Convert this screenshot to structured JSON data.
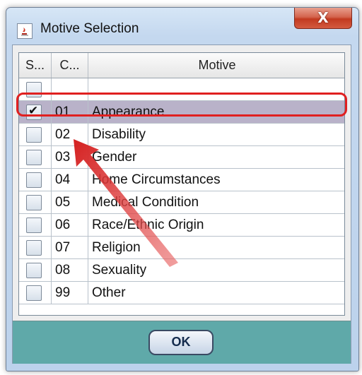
{
  "window": {
    "title": "Motive Selection",
    "close_label": "X"
  },
  "table": {
    "headers": {
      "select": "S...",
      "code": "C...",
      "motive": "Motive"
    },
    "rows": [
      {
        "code": "",
        "motive": "",
        "checked": false
      },
      {
        "code": "01",
        "motive": "Appearance",
        "checked": true
      },
      {
        "code": "02",
        "motive": "Disability",
        "checked": false
      },
      {
        "code": "03",
        "motive": "Gender",
        "checked": false
      },
      {
        "code": "04",
        "motive": "Home Circumstances",
        "checked": false
      },
      {
        "code": "05",
        "motive": "Medical Condition",
        "checked": false
      },
      {
        "code": "06",
        "motive": "Race/Ethnic Origin",
        "checked": false
      },
      {
        "code": "07",
        "motive": "Religion",
        "checked": false
      },
      {
        "code": "08",
        "motive": "Sexuality",
        "checked": false
      },
      {
        "code": "99",
        "motive": "Other",
        "checked": false
      }
    ]
  },
  "footer": {
    "ok_label": "OK"
  },
  "colors": {
    "selected_row": "#b9b2c9",
    "highlight": "#e02020",
    "footer_bg": "#5fa9a9",
    "close_button": "#c23a20"
  },
  "icons": {
    "app": "java-coffee-icon",
    "check": "checkmark-icon"
  }
}
